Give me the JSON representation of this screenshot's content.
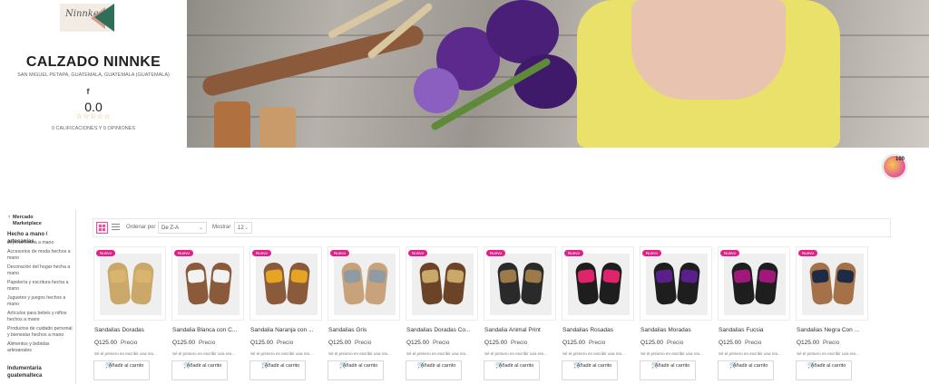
{
  "store": {
    "logo_text": "Ninnke",
    "name": "CALZADO NINNKE",
    "location": "SAN MIGUEL PETAPA, GUATEMALA, GUATEMALA (GUATEMALA)",
    "rating": "0.0",
    "stars": "☆☆☆☆☆",
    "rating_count": "0 CALIFICACIONES Y 0 OPINIONES",
    "badge": "100"
  },
  "sidebar": {
    "back_icon": "chevron-left-icon",
    "title": "Mercado Marketplace",
    "section1": "Hecho a mano / artesanías",
    "items": [
      "Joyería hecha a mano",
      "Accesorios de moda hechos a mano",
      "Decoración del hogar hecha a mano",
      "Papelería y escritura hecha a mano",
      "Juguetes y juegos hechos a mano",
      "Artículos para bebés y niños hechos a mano",
      "Productos de cuidado personal y bienestar hechos a mano",
      "Alimentos y bebidas artesanales"
    ],
    "section2": "Indumentaria guatemalteca"
  },
  "toolbar": {
    "sort_label": "Ordenar por",
    "sort_value": "De Z-A",
    "show_label": "Mostrar",
    "show_value": "12"
  },
  "products": [
    {
      "badge": "Nuevo",
      "name": "Sandalias Doradas",
      "price": "Q125.00",
      "price_label": "Precio",
      "review": "Sé el primero en escribir una res...",
      "button": "Añadir al carrito",
      "color": "#c9a86a",
      "strap": "#d8b46e"
    },
    {
      "badge": "Nuevo",
      "name": "Sandalia Blanca con C...",
      "price": "Q125.00",
      "price_label": "Precio",
      "review": "Sé el primero en escribir una res...",
      "button": "Añadir al carrito",
      "color": "#8a5a3a",
      "strap": "#f2f2f2"
    },
    {
      "badge": "Nuevo",
      "name": "Sandalia Naranja con ...",
      "price": "Q125.00",
      "price_label": "Precio",
      "review": "Sé el primero en escribir una res...",
      "button": "Añadir al carrito",
      "color": "#8a5a3a",
      "strap": "#e6a425"
    },
    {
      "badge": "Nuevo",
      "name": "Sandalias Gris",
      "price": "Q125.00",
      "price_label": "Precio",
      "review": "Sé el primero en escribir una res...",
      "button": "Añadir al carrito",
      "color": "#c7a27a",
      "strap": "#8f9aa3"
    },
    {
      "badge": "Nuevo",
      "name": "Sandalias Doradas Co...",
      "price": "Q125.00",
      "price_label": "Precio",
      "review": "Sé el primero en escribir una res...",
      "button": "Añadir al carrito",
      "color": "#6b4428",
      "strap": "#c9a86a"
    },
    {
      "badge": "Nuevo",
      "name": "Sandalia Animal Print",
      "price": "Q125.00",
      "price_label": "Precio",
      "review": "Sé el primero en escribir una res...",
      "button": "Añadir al carrito",
      "color": "#2a2a2a",
      "strap": "#9c7a4c"
    },
    {
      "badge": "Nuevo",
      "name": "Sandalias Rosadas",
      "price": "Q125.00",
      "price_label": "Precio",
      "review": "Sé el primero en escribir una res...",
      "button": "Añadir al carrito",
      "color": "#1e1e1e",
      "strap": "#e0246c"
    },
    {
      "badge": "Nuevo",
      "name": "Sandalias Moradas",
      "price": "Q125.00",
      "price_label": "Precio",
      "review": "Sé el primero en escribir una res...",
      "button": "Añadir al carrito",
      "color": "#1e1e1e",
      "strap": "#5b1f8c"
    },
    {
      "badge": "Nuevo",
      "name": "Sandalias Fucsia",
      "price": "Q125.00",
      "price_label": "Precio",
      "review": "Sé el primero en escribir una res...",
      "button": "Añadir al carrito",
      "color": "#1e1e1e",
      "strap": "#a0197a"
    },
    {
      "badge": "Nuevo",
      "name": "Sandalias Negra Con ...",
      "price": "Q125.00",
      "price_label": "Precio",
      "review": "Sé el primero en escribir una res...",
      "button": "Añadir al carrito",
      "color": "#a47148",
      "strap": "#1f2b44"
    }
  ],
  "colors": {
    "accent": "#e0218a"
  }
}
